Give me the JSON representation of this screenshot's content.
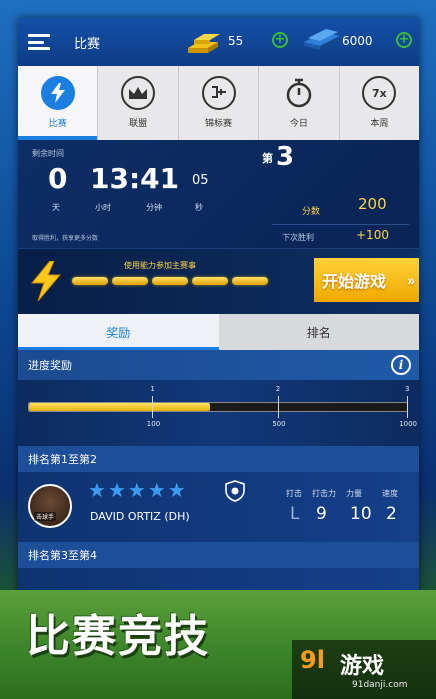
{
  "topbar": {
    "title": "比赛",
    "gold_count": "55",
    "cash_count": "6000"
  },
  "tabs": [
    {
      "label": "比赛",
      "icon": "lightning-icon",
      "active": true
    },
    {
      "label": "联盟",
      "icon": "crown-icon",
      "active": false
    },
    {
      "label": "锦标赛",
      "icon": "bracket-icon",
      "active": false
    },
    {
      "label": "今日",
      "icon": "stopwatch-icon",
      "active": false
    },
    {
      "label": "本周",
      "icon": "seven-x-icon",
      "active": false
    }
  ],
  "tab_icon_text": {
    "week": "7x"
  },
  "countdown": {
    "label": "剩余时间",
    "days": "0",
    "time": "13:41",
    "seconds": "05",
    "unit_day": "天",
    "unit_hour": "小时",
    "unit_min": "分钟",
    "unit_sec": "秒",
    "rank_prefix": "第",
    "rank_number": "3",
    "score_label": "分数",
    "score_value": "200",
    "hint": "取得胜利，获享更多分数",
    "next_win_label": "下次胜利",
    "next_win_value": "+100"
  },
  "energy": {
    "text": "使用能力参加主赛事",
    "start_button": "开始游戏",
    "chevron": "»"
  },
  "subtabs": {
    "reward": "奖励",
    "ranking": "排名"
  },
  "progress": {
    "title": "进度奖励",
    "info": "i",
    "fill_fraction": 0.48,
    "milestones": [
      {
        "top": "1",
        "bottom": "100",
        "fraction": 0.33
      },
      {
        "top": "2",
        "bottom": "500",
        "fraction": 0.66
      },
      {
        "top": "3",
        "bottom": "1000",
        "fraction": 1.0
      }
    ]
  },
  "rank_sections": {
    "first": "排名第1至第2",
    "second": "排名第3至第4"
  },
  "player": {
    "tag": "击球手",
    "name": "DAVID ORTIZ (DH)",
    "stars": 5,
    "stats": [
      {
        "label": "打击",
        "value": "L",
        "dim": true
      },
      {
        "label": "打击力",
        "value": "9",
        "dim": false
      },
      {
        "label": "力量",
        "value": "10",
        "dim": false
      },
      {
        "label": "速度",
        "value": "2",
        "dim": false
      }
    ]
  },
  "banner": {
    "title": "比赛竞技",
    "logo_num": "9l",
    "logo_text": "游戏",
    "logo_url": "91danji.com"
  },
  "colors": {
    "accent": "#1a7fe0",
    "gold": "#ffd34a",
    "plus_green": "#3dbb3d"
  }
}
